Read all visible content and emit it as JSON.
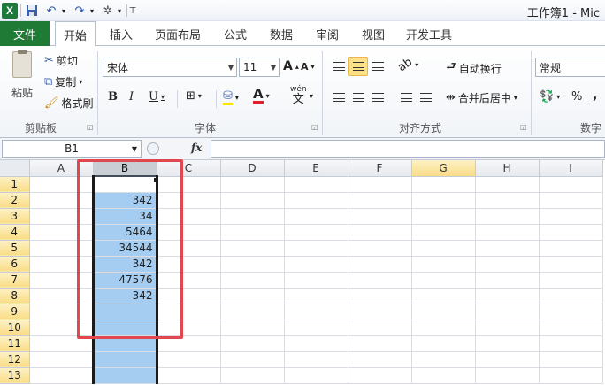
{
  "window": {
    "title": "工作簿1 - Mic"
  },
  "tabs": [
    {
      "label": "文件",
      "active": false
    },
    {
      "label": "开始",
      "active": true
    },
    {
      "label": "插入",
      "active": false
    },
    {
      "label": "页面布局",
      "active": false
    },
    {
      "label": "公式",
      "active": false
    },
    {
      "label": "数据",
      "active": false
    },
    {
      "label": "审阅",
      "active": false
    },
    {
      "label": "视图",
      "active": false
    },
    {
      "label": "开发工具",
      "active": false
    }
  ],
  "ribbon": {
    "clipboard": {
      "paste": "粘贴",
      "cut": "剪切",
      "copy": "复制",
      "format_painter": "格式刷",
      "group_label": "剪贴板"
    },
    "font": {
      "font_name": "宋体",
      "font_size": "11",
      "bold": "B",
      "italic": "I",
      "underline": "U",
      "font_color_glyph": "A",
      "wen": "wén",
      "wen_char": "文",
      "grow_glyph": "A",
      "shrink_glyph": "A",
      "group_label": "字体"
    },
    "alignment": {
      "wrap_text": "自动换行",
      "merge_center": "合并后居中",
      "group_label": "对齐方式"
    },
    "number": {
      "format": "常规",
      "percent": "%",
      "comma": ",",
      "group_label": "数字"
    }
  },
  "formula_bar": {
    "name_box": "B1",
    "fx": "fx",
    "formula": ""
  },
  "columns": [
    "A",
    "B",
    "C",
    "D",
    "E",
    "F",
    "G",
    "H",
    "I"
  ],
  "rows": [
    {
      "num": "1",
      "B": ""
    },
    {
      "num": "2",
      "B": "342"
    },
    {
      "num": "3",
      "B": "34"
    },
    {
      "num": "4",
      "B": "5464"
    },
    {
      "num": "5",
      "B": "34544"
    },
    {
      "num": "6",
      "B": "342"
    },
    {
      "num": "7",
      "B": "47576"
    },
    {
      "num": "8",
      "B": "342"
    },
    {
      "num": "9",
      "B": ""
    },
    {
      "num": "10",
      "B": ""
    },
    {
      "num": "11",
      "B": ""
    },
    {
      "num": "12",
      "B": ""
    },
    {
      "num": "13",
      "B": ""
    }
  ],
  "colors": {
    "file_tab": "#1f7a36",
    "selection": "#a5cdf1",
    "highlight_box": "#e0474f"
  }
}
